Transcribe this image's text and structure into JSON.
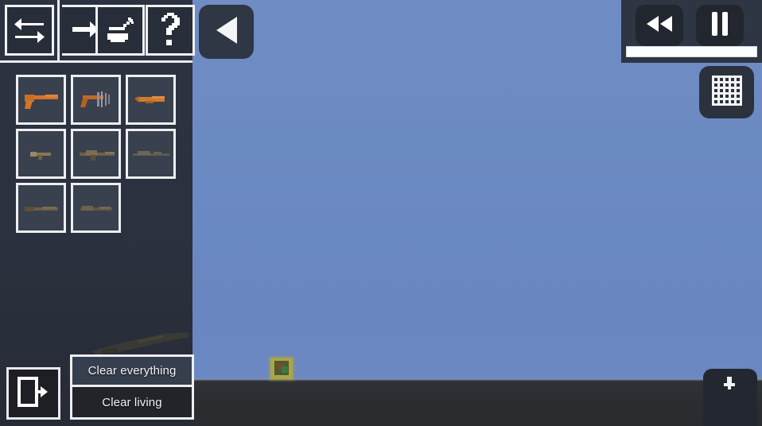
{
  "app": {
    "title": "Sandbox Weapon Selector",
    "colors": {
      "sky": "#6b89c2",
      "ground": "#2c2d31",
      "panel": "#2c323f",
      "slot_bg": "#39404e",
      "border": "#eceef1",
      "creature": "#b0a83c"
    }
  },
  "sidebar": {
    "toolbar": {
      "buttons": [
        {
          "name": "swap-icon",
          "label": "Swap",
          "icon": "swap-arrows-icon"
        },
        {
          "name": "arrow-right-icon",
          "label": "Move",
          "icon": "arrow-right-icon"
        },
        {
          "name": "spray-can-icon",
          "label": "Paint",
          "icon": "spray-can-icon"
        },
        {
          "name": "question-icon",
          "label": "Help",
          "icon": "question-mark-icon"
        }
      ]
    },
    "weapons": {
      "rows": [
        [
          {
            "name": "weapon-slot-1",
            "label": "Pistol",
            "tint": "#d4762a"
          },
          {
            "name": "weapon-slot-2",
            "label": "Revolver",
            "tint": "#c06a28"
          },
          {
            "name": "weapon-slot-3",
            "label": "Sawed-off",
            "tint": "#cf7c33"
          }
        ],
        [
          {
            "name": "weapon-slot-4",
            "label": "SMG",
            "tint": "#8a7754"
          },
          {
            "name": "weapon-slot-5",
            "label": "Assault Rifle",
            "tint": "#6e6148"
          },
          {
            "name": "weapon-slot-6",
            "label": "Sniper Rifle",
            "tint": "#5d5a52"
          }
        ],
        [
          {
            "name": "weapon-slot-7",
            "label": "Shotgun",
            "tint": "#6a5d46"
          },
          {
            "name": "weapon-slot-8",
            "label": "Rifle",
            "tint": "#5f5744"
          }
        ]
      ]
    },
    "exit_button": {
      "label": "Exit",
      "icon": "exit-door-icon"
    },
    "clear_buttons": [
      {
        "label": "Clear everything"
      },
      {
        "label": "Clear living"
      }
    ]
  },
  "overlay": {
    "back_button": {
      "label": "Collapse panel",
      "icon": "triangle-left-icon"
    },
    "playback": {
      "rewind": {
        "label": "Rewind",
        "icon": "rewind-icon"
      },
      "pause": {
        "label": "Pause",
        "icon": "pause-icon"
      },
      "slider": {
        "label": "Time scale",
        "value": "100"
      }
    },
    "grid_toggle": {
      "label": "Toggle grid",
      "icon": "grid-icon"
    },
    "anchor_button": {
      "label": "Anchor",
      "icon": "anchor-pin-icon"
    }
  },
  "world": {
    "creature": {
      "label": "Spawned entity"
    }
  }
}
